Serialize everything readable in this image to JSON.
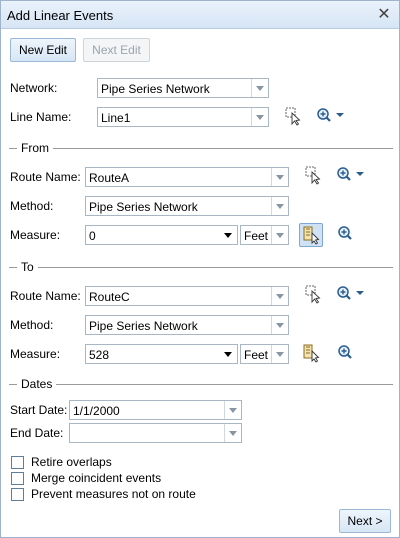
{
  "window": {
    "title": "Add Linear Events"
  },
  "toolbar": {
    "new_edit": "New Edit",
    "next_edit": "Next Edit"
  },
  "network": {
    "label": "Network:",
    "value": "Pipe Series Network"
  },
  "line": {
    "label": "Line Name:",
    "value": "Line1"
  },
  "from": {
    "heading": "From",
    "route_label": "Route Name:",
    "route_value": "RouteA",
    "method_label": "Method:",
    "method_value": "Pipe Series Network",
    "measure_label": "Measure:",
    "measure_value": "0",
    "unit": "Feet"
  },
  "to": {
    "heading": "To",
    "route_label": "Route Name:",
    "route_value": "RouteC",
    "method_label": "Method:",
    "method_value": "Pipe Series Network",
    "measure_label": "Measure:",
    "measure_value": "528",
    "unit": "Feet"
  },
  "dates": {
    "heading": "Dates",
    "start_label": "Start Date:",
    "start_value": "1/1/2000",
    "end_label": "End Date:",
    "end_value": ""
  },
  "options": {
    "retire_overlaps": "Retire overlaps",
    "merge_coincident": "Merge coincident events",
    "prevent_measures": "Prevent measures not on route"
  },
  "footer": {
    "next": "Next >"
  },
  "icons": {
    "close": "close-icon",
    "select_line": "select-on-map-icon",
    "zoom": "zoom-dropdown-icon",
    "measure_pick": "measure-pick-icon"
  }
}
